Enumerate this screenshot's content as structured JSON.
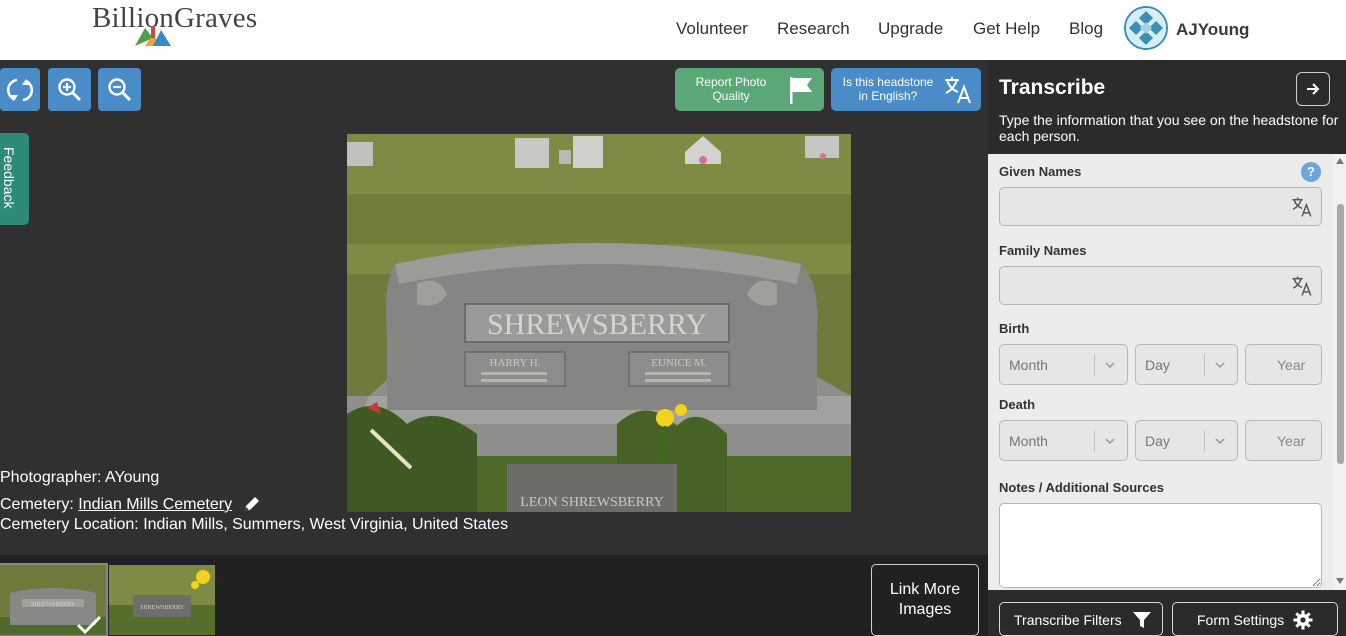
{
  "header": {
    "logo": "BillionGraves",
    "nav": [
      "Volunteer",
      "Research",
      "Upgrade",
      "Get Help",
      "Blog"
    ],
    "username": "AJYoung"
  },
  "viewer": {
    "tools": [
      "rotate-icon",
      "zoom-in-icon",
      "zoom-out-icon"
    ],
    "report_label": "Report Photo Quality",
    "english_label": "Is this headstone in English?",
    "feedback_label": "Feedback",
    "headstone": {
      "surname": "SHREWSBERRY",
      "left_name": "HARRY H.",
      "right_name": "EUNICE M.",
      "foot_marker": "LEON SHREWSBERRY"
    },
    "photographer_label": "Photographer:",
    "photographer": "AYoung",
    "cemetery_label": "Cemetery:",
    "cemetery": "Indian Mills Cemetery",
    "location_label": "Cemetery Location:",
    "location": "Indian Mills, Summers, West Virginia, United States"
  },
  "strip": {
    "thumb_1_text": "SHREWSBERRY",
    "thumb_2_text": "SHREWSBERRY",
    "link_more_label": "Link More Images"
  },
  "panel": {
    "title": "Transcribe",
    "description": "Type the information that you see on the headstone for each person.",
    "given_names_label": "Given Names",
    "family_names_label": "Family Names",
    "birth_label": "Birth",
    "death_label": "Death",
    "month_placeholder": "Month",
    "day_placeholder": "Day",
    "year_placeholder": "Year",
    "notes_label": "Notes / Additional Sources",
    "help": "?",
    "filters_label": "Transcribe Filters",
    "settings_label": "Form Settings"
  },
  "colors": {
    "accent_blue": "#4a8cc8",
    "report_green": "#5aa878",
    "feedback_teal": "#2e8b7a",
    "viewer_bg": "#303030",
    "panel_dark": "#2b2b2b",
    "form_bg": "#ececec"
  }
}
